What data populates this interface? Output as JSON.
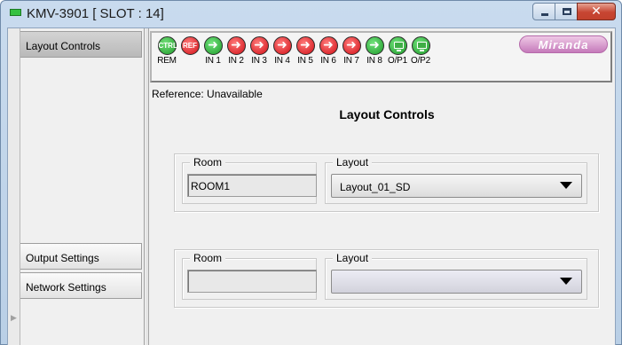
{
  "window": {
    "title": "KMV-3901 [ SLOT : 14]",
    "close_glyph": "✕"
  },
  "nav": {
    "items": [
      {
        "label": "Layout Controls",
        "active": true
      },
      {
        "label": "Output Settings",
        "active": false
      },
      {
        "label": "Network Settings",
        "active": false
      }
    ]
  },
  "status": {
    "indicators": [
      {
        "icon": "ctrl-led",
        "inner": "CTRL",
        "caption": "REM",
        "color": "green"
      },
      {
        "icon": "ref-led",
        "inner": "REF",
        "caption": "",
        "color": "red"
      },
      {
        "icon": "input-arrow-icon",
        "caption": "IN 1",
        "color": "green"
      },
      {
        "icon": "input-arrow-icon",
        "caption": "IN 2",
        "color": "red"
      },
      {
        "icon": "input-arrow-icon",
        "caption": "IN 3",
        "color": "red"
      },
      {
        "icon": "input-arrow-icon",
        "caption": "IN 4",
        "color": "red"
      },
      {
        "icon": "input-arrow-icon",
        "caption": "IN 5",
        "color": "red"
      },
      {
        "icon": "input-arrow-icon",
        "caption": "IN 6",
        "color": "red"
      },
      {
        "icon": "input-arrow-icon",
        "caption": "IN 7",
        "color": "red"
      },
      {
        "icon": "input-arrow-icon",
        "caption": "IN 8",
        "color": "green"
      },
      {
        "icon": "monitor-icon",
        "caption": "O/P1",
        "color": "green"
      },
      {
        "icon": "monitor-icon",
        "caption": "O/P2",
        "color": "green"
      }
    ],
    "logo": "Miranda"
  },
  "reference_text": "Reference: Unavailable",
  "panel_title": "Layout Controls",
  "groups": [
    {
      "room_label": "Room",
      "room_value": "ROOM1",
      "layout_label": "Layout",
      "layout_value": "Layout_01_SD"
    },
    {
      "room_label": "Room",
      "room_value": "",
      "layout_label": "Layout",
      "layout_value": ""
    }
  ],
  "colors": {
    "ok": "#1e9a2a",
    "error": "#d10f16",
    "logo": "#c57aba"
  }
}
